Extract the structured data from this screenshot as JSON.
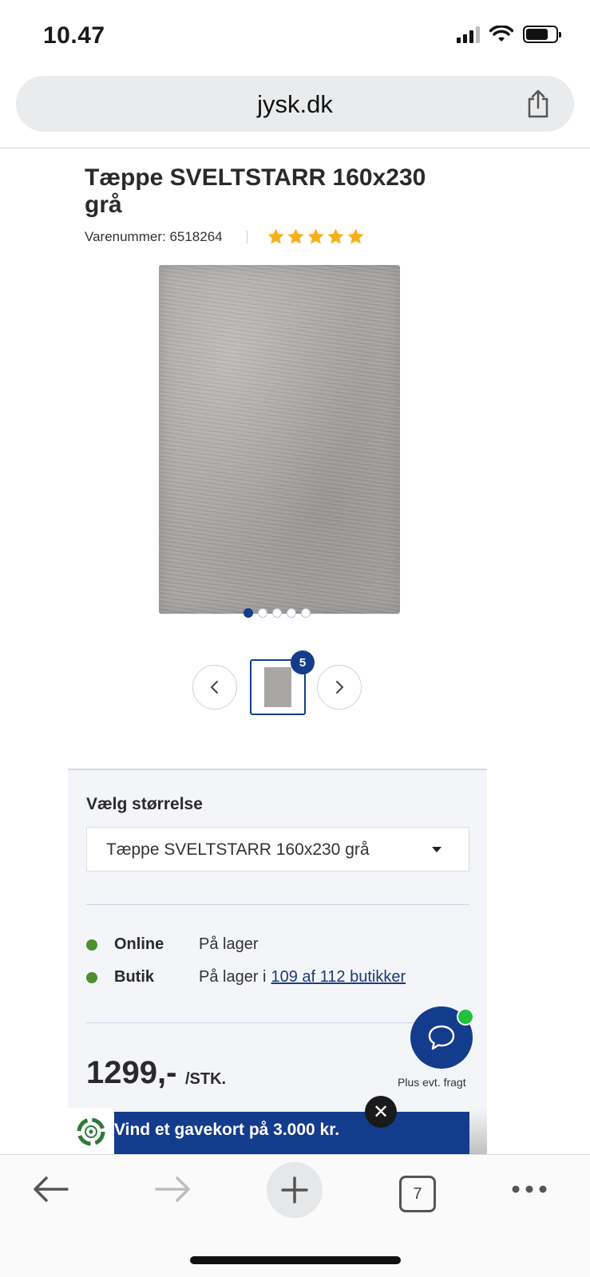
{
  "status_bar": {
    "time": "10.47"
  },
  "browser": {
    "url": "jysk.dk",
    "tab_count": "7"
  },
  "product": {
    "title": "Tæppe SVELTSTARR 160x230 grå",
    "sku": "Varenummer: 6518264",
    "rating_stars": 5,
    "image_count": "5",
    "gallery_dots": 5,
    "gallery_active_index": 0
  },
  "size_selector": {
    "label": "Vælg størrelse",
    "selected": "Tæppe SVELTSTARR 160x230 grå"
  },
  "stock": {
    "online_label": "Online",
    "online_status": "På lager",
    "store_label": "Butik",
    "store_status_prefix": "På lager i",
    "store_link": "109 af 112 butikker"
  },
  "price": {
    "amount": "1299,-",
    "unit": "/STK.",
    "freight_note": "Plus evt. fragt"
  },
  "banner": {
    "text": "Vind et gavekort på 3.000 kr.",
    "close": "✕"
  },
  "colors": {
    "brand_blue": "#143c8c",
    "stock_green": "#4d8f2f",
    "star_yellow": "#f6b11a",
    "chat_online": "#1fc23a"
  }
}
